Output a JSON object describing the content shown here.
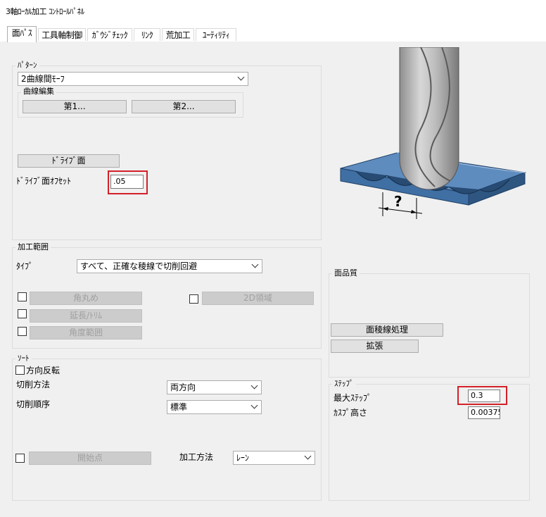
{
  "window": {
    "title": "3軸ﾛｰｶﾙ加工 ｺﾝﾄﾛｰﾙﾊﾟﾈﾙ"
  },
  "tabs": [
    {
      "label": "面ﾊﾟｽ"
    },
    {
      "label": "工具軸制御"
    },
    {
      "label": "ｶﾞｳｼﾞﾁｪｯｸ"
    },
    {
      "label": "ﾘﾝｸ"
    },
    {
      "label": "荒加工"
    },
    {
      "label": "ﾕｰﾃｨﾘﾃｨ"
    }
  ],
  "pattern": {
    "group_label": "ﾊﾟﾀｰﾝ",
    "mode_value": "2曲線間ﾓｰﾌ",
    "curve_edit_label": "曲線編集",
    "first_button": "第1...",
    "second_button": "第2...",
    "drive_surface_button": "ﾄﾞﾗｲﾌﾞ面",
    "drive_offset_label": "ﾄﾞﾗｲﾌﾞ面ｵﾌｾｯﾄ",
    "drive_offset_value": ".05"
  },
  "illustration": {
    "question_mark": "?"
  },
  "machining_range": {
    "group_label": "加工範囲",
    "type_label": "ﾀｲﾌﾟ",
    "type_value": "すべて、正確な稜線で切削回避",
    "fillet_button": "角丸め",
    "extend_trim_button": "延長/ﾄﾘﾑ",
    "angle_range_button": "角度範囲",
    "region_2d_button": "2D領域"
  },
  "surface_quality": {
    "group_label": "面品質",
    "edge_processing_button": "面稜線処理",
    "expand_button": "拡張"
  },
  "sort": {
    "group_label": "ｿｰﾄ",
    "reverse_label": "方向反転",
    "cut_method_label": "切削方法",
    "cut_method_value": "両方向",
    "cut_order_label": "切削順序",
    "cut_order_value": "標準",
    "start_point_button": "開始点",
    "machining_method_label": "加工方法",
    "machining_method_value": "ﾚｰﾝ"
  },
  "step": {
    "group_label": "ｽﾃｯﾌﾟ",
    "max_step_label": "最大ｽﾃｯﾌﾟ",
    "max_step_value": "0.3",
    "cusp_height_label": "ｶｽﾌﾟ高さ",
    "cusp_height_value": "0.00375:"
  },
  "colors": {
    "highlight": "#d42027",
    "panel_bg": "#f0f0f0",
    "surface_blue": "#4a78a8"
  }
}
